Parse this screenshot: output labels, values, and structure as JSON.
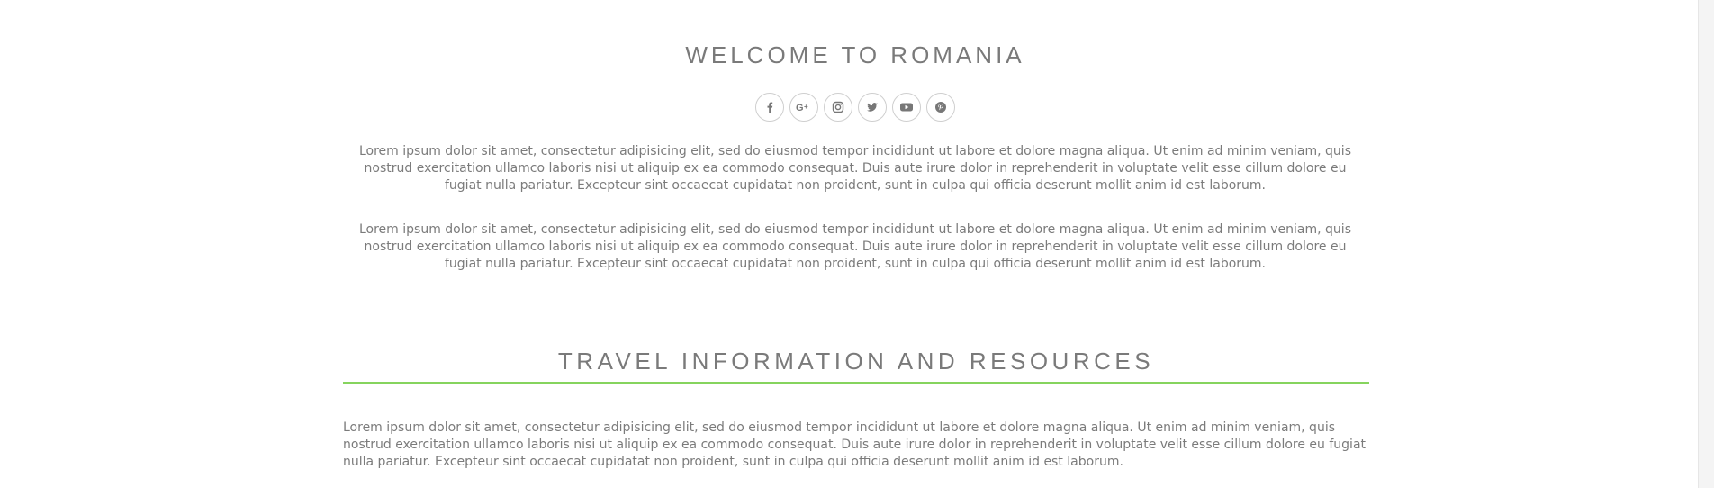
{
  "welcome": {
    "title": "WELCOME TO ROMANIA",
    "social_icons": [
      {
        "name": "facebook-icon",
        "glyph": "f"
      },
      {
        "name": "google-plus-icon",
        "glyph": "G+"
      },
      {
        "name": "instagram-icon",
        "glyph": "instagram"
      },
      {
        "name": "twitter-icon",
        "glyph": "twitter"
      },
      {
        "name": "youtube-icon",
        "glyph": "youtube"
      },
      {
        "name": "pinterest-icon",
        "glyph": "pinterest"
      }
    ],
    "paragraph_1": "Lorem ipsum dolor sit amet, consectetur adipisicing elit, sed do eiusmod tempor incididunt ut labore et dolore magna aliqua. Ut enim ad minim veniam, quis nostrud exercitation ullamco laboris nisi ut aliquip ex ea commodo consequat. Duis aute irure dolor in reprehenderit in voluptate velit esse cillum dolore eu fugiat nulla pariatur. Excepteur sint occaecat cupidatat non proident, sunt in culpa qui officia deserunt mollit anim id est laborum.",
    "paragraph_2": "Lorem ipsum dolor sit amet, consectetur adipisicing elit, sed do eiusmod tempor incididunt ut labore et dolore magna aliqua. Ut enim ad minim veniam, quis nostrud exercitation ullamco laboris nisi ut aliquip ex ea commodo consequat. Duis aute irure dolor in reprehenderit in voluptate velit esse cillum dolore eu fugiat nulla pariatur. Excepteur sint occaecat cupidatat non proident, sunt in culpa qui officia deserunt mollit anim id est laborum."
  },
  "travel": {
    "title": "TRAVEL INFORMATION AND RESOURCES",
    "paragraph": "Lorem ipsum dolor sit amet, consectetur adipisicing elit, sed do eiusmod tempor incididunt ut labore et dolore magna aliqua. Ut enim ad minim veniam, quis nostrud exercitation ullamco laboris nisi ut aliquip ex ea commodo consequat. Duis aute irure dolor in reprehenderit in voluptate velit esse cillum dolore eu fugiat nulla pariatur. Excepteur sint occaecat cupidatat non proident, sunt in culpa qui officia deserunt mollit anim id est laborum."
  },
  "colors": {
    "text": "#777777",
    "accent_divider": "#86d45e",
    "icon_border": "#cfcfcf",
    "background": "#ffffff"
  }
}
